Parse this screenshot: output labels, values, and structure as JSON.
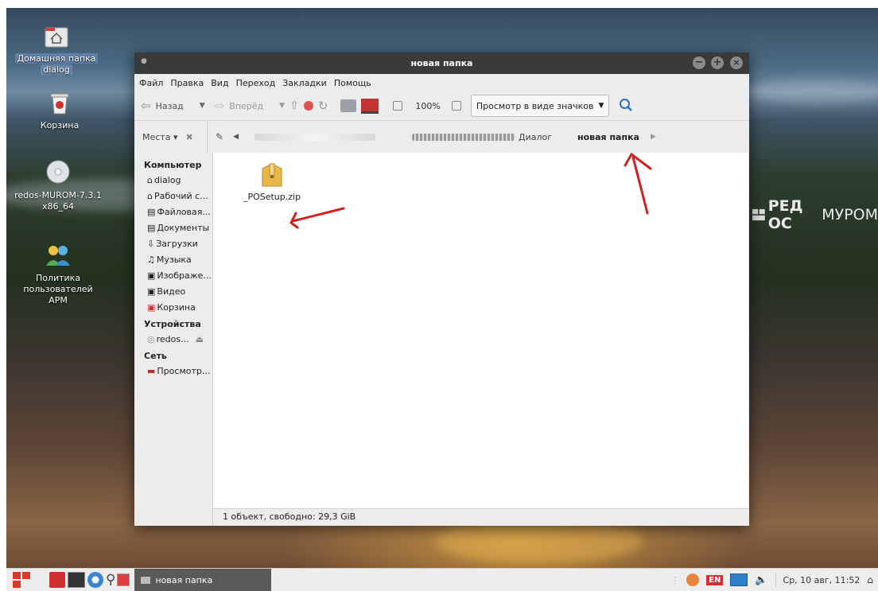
{
  "desktop": {
    "icons": [
      {
        "label": "Домашняя папка",
        "label2": "dialog",
        "icon": "home-folder-icon"
      },
      {
        "label": "Корзина",
        "label2": "",
        "icon": "trash-icon"
      },
      {
        "label": "redos-MUROM-7.3.1",
        "label2": "x86_64",
        "icon": "disc-icon"
      },
      {
        "label": "Политика",
        "label2": "пользователей АРМ",
        "icon": "users-icon"
      }
    ],
    "brand": {
      "part1": "РЕД ОС",
      "part2": "МУРОМ"
    }
  },
  "window": {
    "title": "новая папка",
    "menu": [
      "Файл",
      "Правка",
      "Вид",
      "Переход",
      "Закладки",
      "Помощь"
    ],
    "toolbar": {
      "back": "Назад",
      "forward": "Вперёд",
      "zoom": "100%",
      "view_mode": "Просмотр в виде значков"
    },
    "places_toggle": "Места",
    "breadcrumbs": [
      "Диалог",
      "новая папка"
    ],
    "sidebar": {
      "computer_heading": "Компьютер",
      "computer_items": [
        {
          "label": "dialog",
          "icon": "home-icon"
        },
        {
          "label": "Рабочий с...",
          "icon": "desktop-icon"
        },
        {
          "label": "Файловая...",
          "icon": "filesystem-icon"
        },
        {
          "label": "Документы",
          "icon": "documents-icon"
        },
        {
          "label": "Загрузки",
          "icon": "downloads-icon"
        },
        {
          "label": "Музыка",
          "icon": "music-icon"
        },
        {
          "label": "Изображе...",
          "icon": "pictures-icon"
        },
        {
          "label": "Видео",
          "icon": "video-icon"
        },
        {
          "label": "Корзина",
          "icon": "trash-icon"
        }
      ],
      "devices_heading": "Устройства",
      "devices_items": [
        {
          "label": "redos...",
          "icon": "disc-icon"
        }
      ],
      "network_heading": "Сеть",
      "network_items": [
        {
          "label": "Просмотр...",
          "icon": "network-icon"
        }
      ]
    },
    "files": [
      {
        "name": "_POSetup.zip",
        "icon": "zip-archive-icon"
      }
    ],
    "status": "1 объект, свободно: 29,3 GiB"
  },
  "taskbar": {
    "task_label": "новая папка",
    "keyboard_layout": "EN",
    "clock": "Ср, 10 авг, 11:52"
  },
  "colors": {
    "titlebar": "#3a3a3a",
    "annotation": "#d42020",
    "taskbar_active": "#5a5a5a"
  }
}
